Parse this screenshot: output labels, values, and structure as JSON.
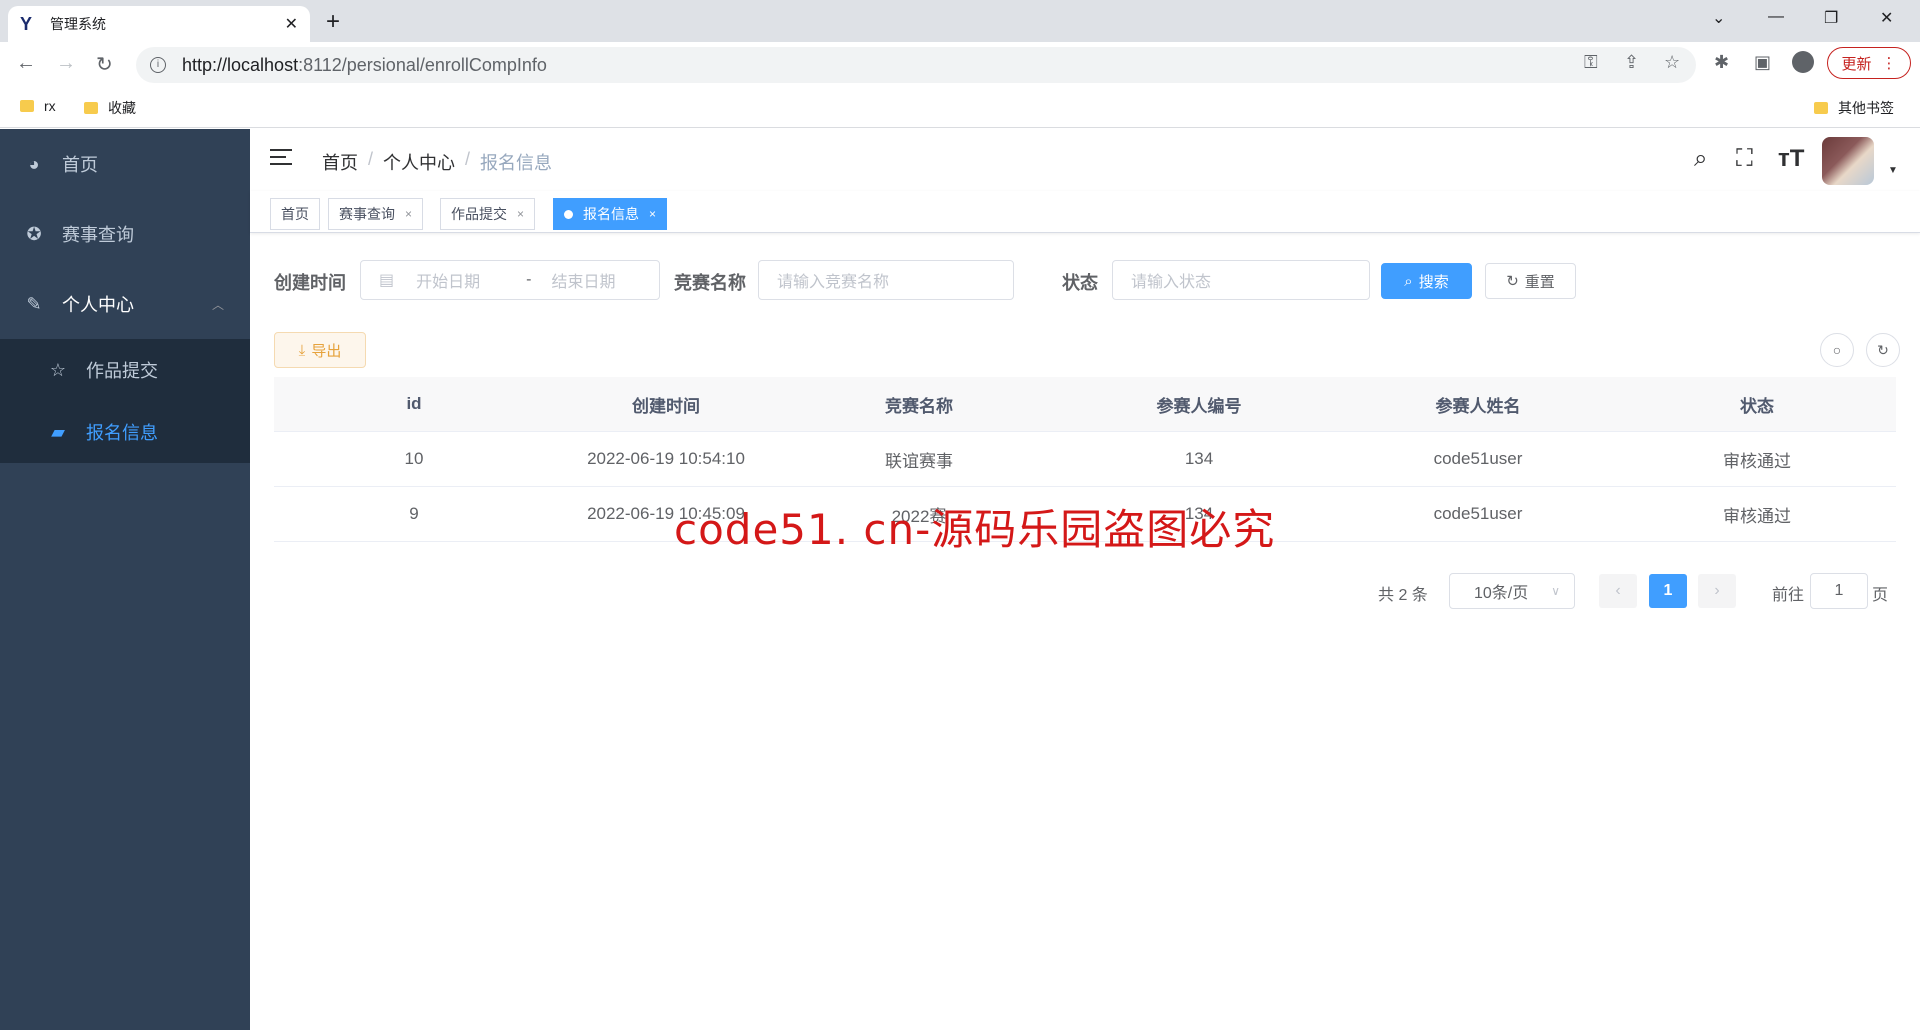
{
  "browser": {
    "tab_title": "管理系统",
    "url_host": "http://localhost",
    "url_path": ":8112/persional/enrollCompInfo",
    "update_label": "更新",
    "bookmarks": [
      "rx",
      "收藏"
    ],
    "other_bookmarks": "其他书签"
  },
  "sidebar": {
    "items": [
      {
        "label": "首页",
        "icon": "dashboard-icon"
      },
      {
        "label": "赛事查询",
        "icon": "compass-icon"
      },
      {
        "label": "个人中心",
        "icon": "edit-icon"
      }
    ],
    "subitems": [
      {
        "label": "作品提交",
        "icon": "star-icon"
      },
      {
        "label": "报名信息",
        "icon": "message-icon"
      }
    ]
  },
  "breadcrumb": [
    "首页",
    "个人中心",
    "报名信息"
  ],
  "tags": [
    {
      "label": "首页"
    },
    {
      "label": "赛事查询"
    },
    {
      "label": "作品提交"
    },
    {
      "label": "报名信息"
    }
  ],
  "search": {
    "created_label": "创建时间",
    "start_placeholder": "开始日期",
    "range_sep": "-",
    "end_placeholder": "结束日期",
    "name_label": "竞赛名称",
    "name_placeholder": "请输入竞赛名称",
    "status_label": "状态",
    "status_placeholder": "请输入状态",
    "search_btn": "搜索",
    "reset_btn": "重置",
    "export_btn": "导出"
  },
  "table": {
    "headers": [
      "id",
      "创建时间",
      "竞赛名称",
      "参赛人编号",
      "参赛人姓名",
      "状态"
    ],
    "rows": [
      [
        "10",
        "2022-06-19 10:54:10",
        "联谊赛事",
        "134",
        "code51user",
        "审核通过"
      ],
      [
        "9",
        "2022-06-19 10:45:09",
        "2022赛",
        "134",
        "code51user",
        "审核通过"
      ]
    ]
  },
  "pagination": {
    "total": "共 2 条",
    "page_size": "10条/页",
    "current": "1",
    "goto_label": "前往",
    "goto_value": "1",
    "page_suffix": "页"
  },
  "watermark": "code51. cn-源码乐园盗图必究",
  "colors": {
    "sidebar_bg": "#304156",
    "primary": "#409eff",
    "watermark": "#d41818"
  }
}
